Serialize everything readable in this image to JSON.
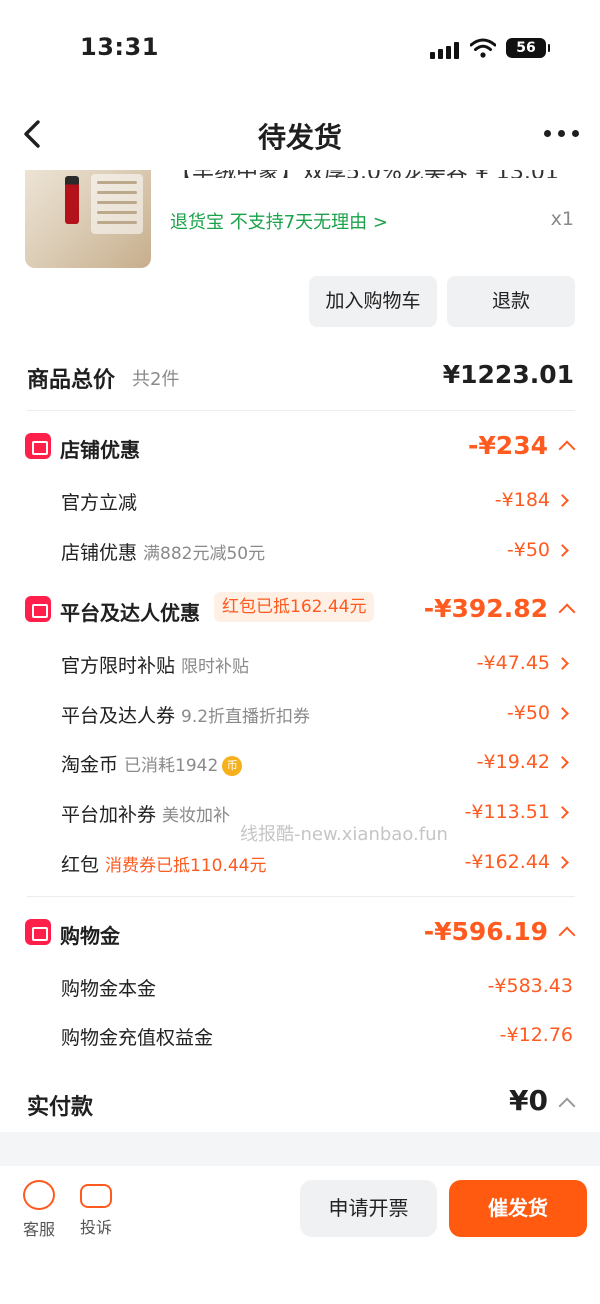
{
  "status_bar": {
    "time": "13:31",
    "battery": "56"
  },
  "nav": {
    "title": "待发货"
  },
  "product": {
    "name_partial": "【羊绒中蒙】双厚5.0%宠美容 ¥ 13.01",
    "return_text": "退货宝  不支持7天无理由 >",
    "quantity": "x1"
  },
  "actions": {
    "add_cart": "加入购物车",
    "refund": "退款"
  },
  "total": {
    "label": "商品总价",
    "count": "共2件",
    "price": "¥1223.01"
  },
  "store_discount": {
    "title": "店铺优惠",
    "amount": "-¥234",
    "items": [
      {
        "label": "官方立减",
        "sub": "",
        "amount": "-¥184"
      },
      {
        "label": "店铺优惠",
        "sub": "满882元减50元",
        "amount": "-¥50"
      }
    ]
  },
  "platform_discount": {
    "title": "平台及达人优惠",
    "badge": "红包已抵162.44元",
    "amount": "-¥392.82",
    "items": [
      {
        "label": "官方限时补贴",
        "sub": "限时补贴",
        "amount": "-¥47.45"
      },
      {
        "label": "平台及达人券",
        "sub": "9.2折直播折扣券",
        "amount": "-¥50"
      },
      {
        "label": "淘金币",
        "sub": "已消耗1942",
        "amount": "-¥19.42"
      },
      {
        "label": "平台加补券",
        "sub": "美妆加补",
        "amount": "-¥113.51"
      },
      {
        "label": "红包",
        "sub": "消费券已抵110.44元",
        "amount": "-¥162.44"
      }
    ]
  },
  "shopping_gold": {
    "title": "购物金",
    "amount": "-¥596.19",
    "items": [
      {
        "label": "购物金本金",
        "amount": "-¥583.43"
      },
      {
        "label": "购物金充值权益金",
        "amount": "-¥12.76"
      }
    ]
  },
  "payment": {
    "label": "实付款",
    "amount": "¥0"
  },
  "watermark": "线报酷-new.xianbao.fun",
  "bottom": {
    "service": "客服",
    "complain": "投诉",
    "invoice": "申请开票",
    "urge": "催发货"
  },
  "colors": {
    "accent": "#ff5a1f",
    "green": "#1aa34a",
    "section_icon": "#ff1f4b"
  }
}
